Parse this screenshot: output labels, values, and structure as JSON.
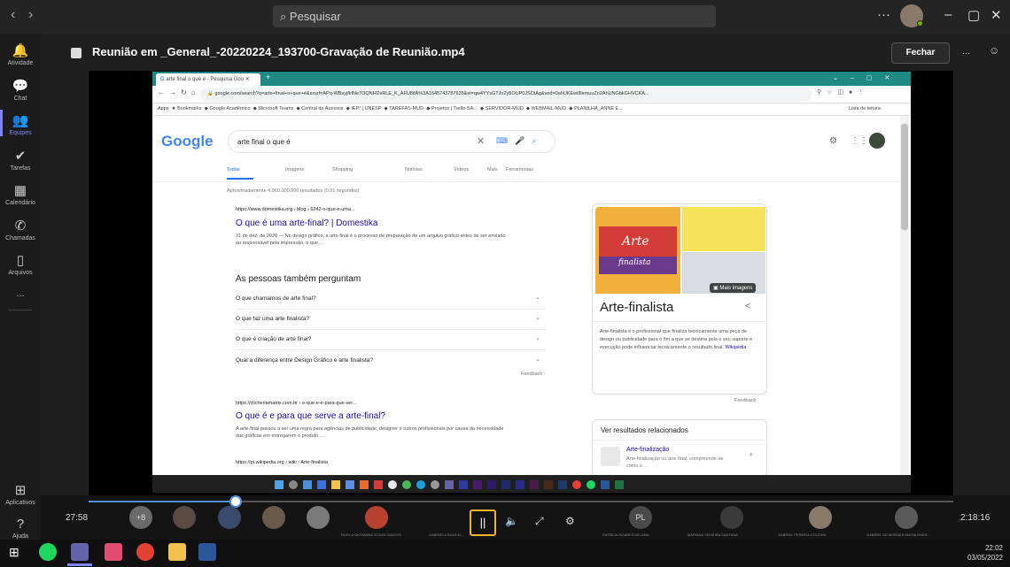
{
  "teams": {
    "search_placeholder": "Pesquisar",
    "meeting_title": "Reunião em _General_-20220224_193700-Gravação de Reunião.mp4",
    "close_label": "Fechar",
    "more_label": "...",
    "rail": [
      {
        "label": "Atividade",
        "icon": "bell-icon",
        "glyph": "🔔"
      },
      {
        "label": "Chat",
        "icon": "chat-icon",
        "glyph": "💬"
      },
      {
        "label": "Equipes",
        "icon": "teams-icon",
        "glyph": "👥"
      },
      {
        "label": "Tarefas",
        "icon": "tasks-icon",
        "glyph": "✔"
      },
      {
        "label": "Calendário",
        "icon": "calendar-icon",
        "glyph": "▦"
      },
      {
        "label": "Chamadas",
        "icon": "phone-icon",
        "glyph": "✆"
      },
      {
        "label": "Arquivos",
        "icon": "file-icon",
        "glyph": "▯"
      },
      {
        "label": "Aplicativos",
        "icon": "apps-icon",
        "glyph": "⊞"
      },
      {
        "label": "Ajuda",
        "icon": "help-icon",
        "glyph": "?"
      }
    ],
    "rail_more": "...",
    "accent": "#7f85f5"
  },
  "player": {
    "time_current": "27:58",
    "time_total": "2:18:16",
    "progress_fraction": 0.17,
    "participants_overflow": "+8",
    "participant_initials": "PL",
    "participant_names": [
      "THAYLA GIOVANNA SOUZA SANTOS",
      "GABRIELA SILVA M...",
      "PATRICIA SOARES DE LIMA",
      "MARIANA TEIXEIRA SANTANA",
      "GABRIEL PEREIRA COUGHA",
      "GABRIEL DE MORAES MAGALHAES..."
    ]
  },
  "browser": {
    "tab_title": "arte final o que é - Pesquisa Goo",
    "url": "google.com/search?q=arte+final+o+que+é&sxsrf=APq-WBsyjfkfNe7OQNHDsRLE_K_AFU8ifA%3A1645743787635&ei=qw4YYsGTJo2y5OUP0JSOiAg&ved=0ahUKEwi8lemuuZn2AhUNGbkGHVCKA...",
    "bookmarks": [
      "Apps",
      "Bookmarks",
      "Google Acadêmico",
      "Microsoft Teams",
      "Central de Acessos",
      "IEP³ | UNESP",
      "TAREFAS-MUD",
      "Projetos | Trello-SA...",
      "SERVIDOR-MUD",
      "WEBMAIL-MUD",
      "PLANILHA_ANNE E...",
      "Lista de leitura"
    ],
    "search": {
      "logo": "Google",
      "query": "arte final o que é",
      "tabs": [
        "Todas",
        "Imagens",
        "Shopping",
        "Notícias",
        "Vídeos",
        "Mais",
        "Ferramentas"
      ],
      "stats": "Aproximadamente 4.960.000.000 resultados (0,91 segundos)",
      "results": [
        {
          "crumb": "https://www.domestika.org › blog › 6242-o-que-e-uma...",
          "title": "O que é uma arte-final? | Domestika",
          "snippet": "31 de dez. de 2020 — No design gráfico, a arte-final é o processo de preparação de um arquivo gráfico antes de ser enviado ao responsável pela impressão, o que ..."
        },
        {
          "crumb": "https://clicheriamatrix.com.br › o-que-e-e-para-que-ser...",
          "title": "O que é e para que serve a arte-final?",
          "snippet": "A arte-final passou a ser uma regra para agências de publicidade, designer e outros profissionais por causa da necessidade das gráficas em entregarem o produto ..."
        },
        {
          "crumb": "https://pt.wikipedia.org › wiki › Arte-finalista",
          "title": "",
          "snippet": ""
        }
      ],
      "paa_title": "As pessoas também perguntam",
      "paa": [
        "O que chamamos de arte final?",
        "O que faz uma arte finalista?",
        "O que é criação de arte final?",
        "Qual a diferença entre Design Gráfico e arte finalista?"
      ],
      "feedback": "Feedback",
      "kp": {
        "title": "Arte-finalista",
        "logo_line1": "Arte",
        "logo_line2": "finalista",
        "more_images": "Mais imagens",
        "desc": "Arte-finalista é o profissional que finaliza tecnicamente uma peça de design ou publicidade para o fim a que se destina pois o seu suporte e execução pode influenciar tecnicamente o resultado final.",
        "source": "Wikipédia",
        "feedback": "Feedback"
      },
      "related": {
        "title": "Ver resultados relacionados",
        "item_title": "Arte-finalização",
        "item_sub": "Arte-finalização ou arte final, compreende-se como o ..."
      }
    }
  },
  "clock": {
    "time": "22:02",
    "date": "03/05/2022"
  }
}
